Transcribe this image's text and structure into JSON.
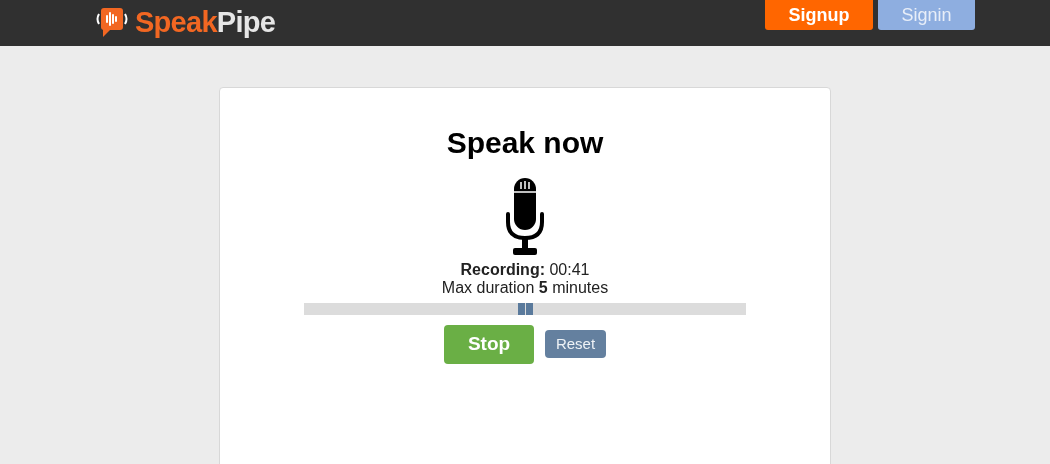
{
  "header": {
    "logo": {
      "first": "Speak",
      "second": "Pipe"
    },
    "buttons": [
      "Signup",
      "Signin"
    ]
  },
  "recorder": {
    "title": "Speak now",
    "status": "**Recording:** 00:41",
    "limit": "Max duration **5** minutes",
    "buttons": [
      "Stop",
      "Reset"
    ]
  }
}
